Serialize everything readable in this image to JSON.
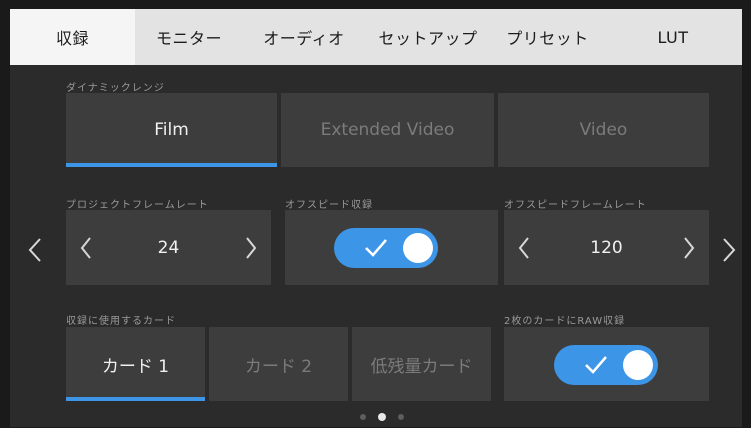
{
  "tabs": [
    {
      "label": "収録",
      "active": true
    },
    {
      "label": "モニター",
      "active": false
    },
    {
      "label": "オーディオ",
      "active": false
    },
    {
      "label": "セットアップ",
      "active": false
    },
    {
      "label": "プリセット",
      "active": false
    },
    {
      "label": "LUT",
      "active": false
    }
  ],
  "dynamic_range": {
    "label": "ダイナミックレンジ",
    "options": [
      {
        "label": "Film",
        "selected": true
      },
      {
        "label": "Extended Video",
        "selected": false
      },
      {
        "label": "Video",
        "selected": false
      }
    ]
  },
  "project_frame_rate": {
    "label": "プロジェクトフレームレート",
    "value": "24"
  },
  "off_speed_recording": {
    "label": "オフスピード収録",
    "enabled": true
  },
  "off_speed_frame_rate": {
    "label": "オフスピードフレームレート",
    "value": "120"
  },
  "record_card": {
    "label": "収録に使用するカード",
    "options": [
      {
        "label": "カード 1",
        "selected": true
      },
      {
        "label": "カード 2",
        "selected": false
      },
      {
        "label": "低残量カード",
        "selected": false
      }
    ]
  },
  "raw_two_cards": {
    "label": "2枚のカードにRAW収録",
    "enabled": true
  },
  "pagination": {
    "current": 2,
    "total": 3
  },
  "colors": {
    "accent": "#3d95e8",
    "tile": "#3d3d3d",
    "background": "#2b2b2b",
    "tabbar": "#e3e3e3"
  },
  "icons": {
    "prev_page": "chevron-left-icon",
    "next_page": "chevron-right-icon",
    "toggle_on": "checkmark-icon"
  }
}
